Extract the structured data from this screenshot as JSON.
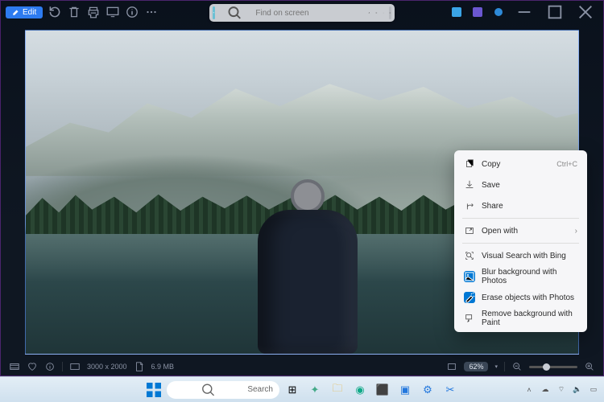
{
  "toolbar": {
    "edit_label": "Edit"
  },
  "search": {
    "placeholder": "Find on screen"
  },
  "context_menu": {
    "copy": "Copy",
    "copy_shortcut": "Ctrl+C",
    "save": "Save",
    "share": "Share",
    "open_with": "Open with",
    "visual_search": "Visual Search with Bing",
    "blur_bg": "Blur background with Photos",
    "erase_obj": "Erase objects with Photos",
    "remove_bg": "Remove background with Paint"
  },
  "status": {
    "dimensions": "3000 x 2000",
    "filesize": "6.9 MB",
    "zoom": "62%"
  },
  "taskbar": {
    "search_placeholder": "Search"
  }
}
